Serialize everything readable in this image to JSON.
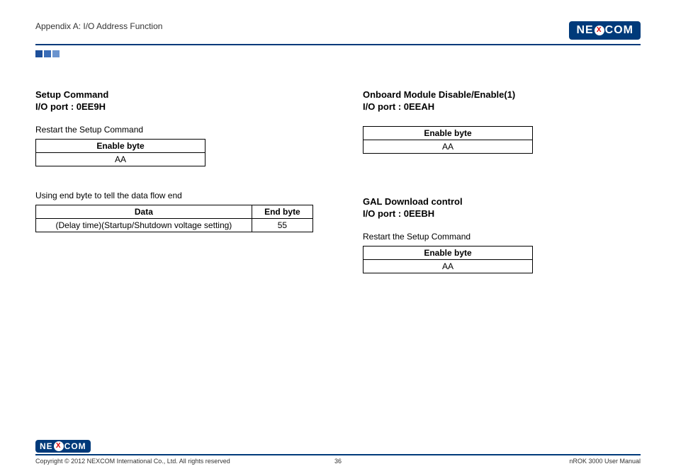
{
  "header": {
    "appendix": "Appendix A: I/O Address Function",
    "logo_text_left": "NE",
    "logo_x": "X",
    "logo_text_right": "COM"
  },
  "left": {
    "section1_title1": "Setup Command",
    "section1_title2": "I/O port : 0EE9H",
    "restart_label": "Restart the Setup Command",
    "table1": {
      "header": "Enable byte",
      "value": "AA"
    },
    "flow_note": "Using end byte to tell the data flow end",
    "table2": {
      "h1": "Data",
      "h2": "End byte",
      "r1c1": "(Delay time)(Startup/Shutdown voltage setting)",
      "r1c2": "55"
    }
  },
  "right": {
    "section1_title1": "Onboard Module Disable/Enable(1)",
    "section1_title2": "I/O port : 0EEAH",
    "table1": {
      "header": "Enable byte",
      "value": "AA"
    },
    "section2_title1": "GAL Download control",
    "section2_title2": "I/O port : 0EEBH",
    "restart_label": "Restart the Setup Command",
    "table2": {
      "header": "Enable byte",
      "value": "AA"
    }
  },
  "footer": {
    "copyright": "Copyright © 2012 NEXCOM International Co., Ltd. All rights reserved",
    "page": "36",
    "manual": "nROK 3000 User Manual"
  }
}
